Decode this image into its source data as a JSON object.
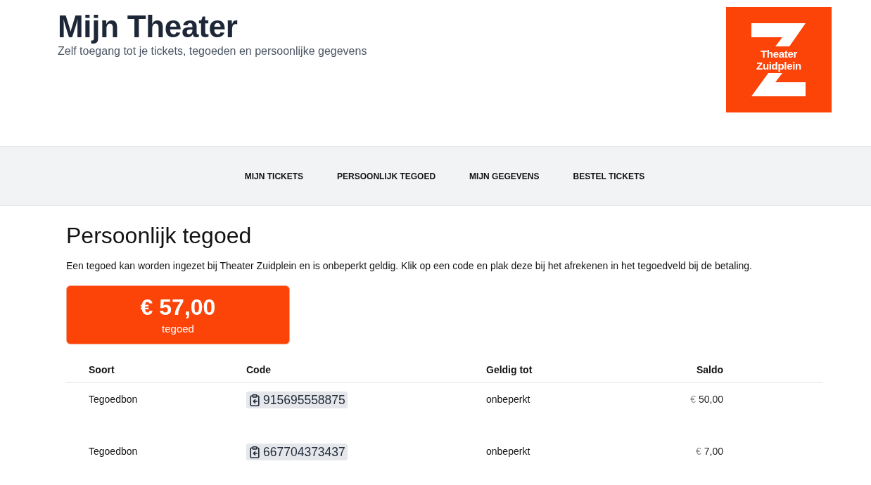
{
  "header": {
    "title": "Mijn Theater",
    "subtitle": "Zelf toegang tot je tickets, tegoeden en persoonlijke gegevens",
    "logo": {
      "lines": [
        "Theater",
        "Zuidplein"
      ]
    }
  },
  "nav": {
    "items": [
      {
        "label": "MIJN TICKETS"
      },
      {
        "label": "PERSOONLIJK TEGOED"
      },
      {
        "label": "MIJN GEGEVENS"
      },
      {
        "label": "BESTEL TICKETS"
      }
    ]
  },
  "page": {
    "heading": "Persoonlijk tegoed",
    "intro": "Een tegoed kan worden ingezet bij Theater Zuidplein en is onbeperkt geldig. Klik op een code en plak deze bij het afrekenen in het tegoedveld bij de betaling.",
    "balance": {
      "amount": "€ 57,00",
      "label": "tegoed"
    }
  },
  "table": {
    "columns": [
      "Soort",
      "Code",
      "Geldig tot",
      "Saldo"
    ],
    "rows": [
      {
        "soort": "Tegoedbon",
        "code": "915695558875",
        "geldig_tot": "onbeperkt",
        "currency": "€",
        "amount": "50,00"
      },
      {
        "soort": "Tegoedbon",
        "code": "667704373437",
        "geldig_tot": "onbeperkt",
        "currency": "€",
        "amount": "7,00"
      }
    ]
  }
}
